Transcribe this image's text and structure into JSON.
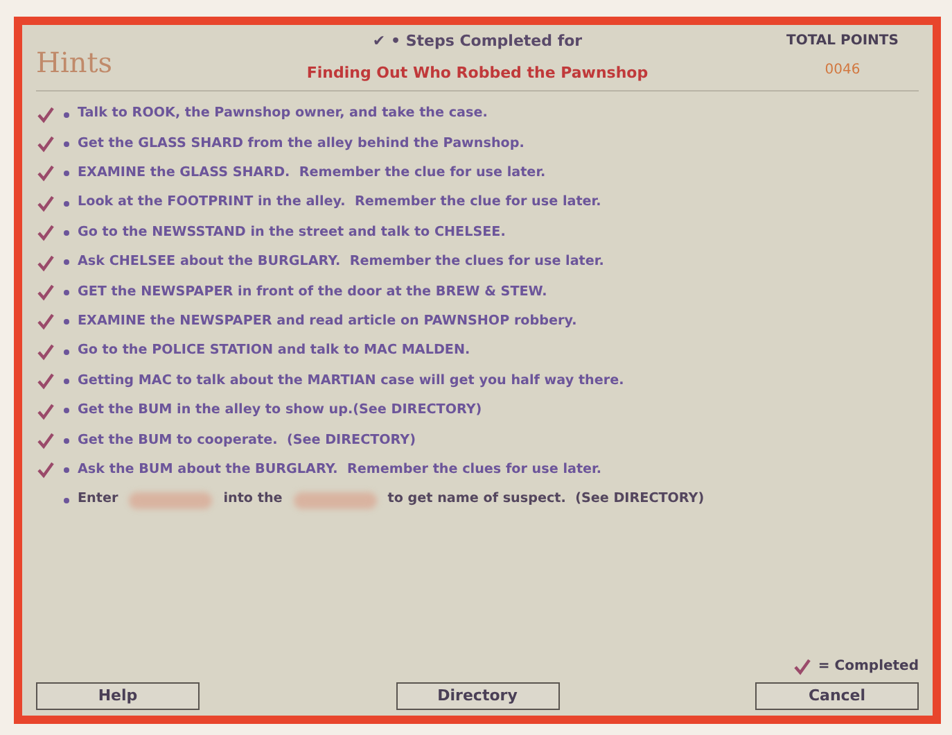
{
  "window": {
    "title": "Hints"
  },
  "header": {
    "legend": "✔ • Steps Completed for",
    "task": "Finding Out Who Robbed the Pawnshop",
    "points_label": "TOTAL POINTS",
    "points": "0046"
  },
  "steps": [
    {
      "checked": true,
      "parts": [
        {
          "kind": "text",
          "text": "Talk to ROOK, the Pawnshop owner, and take the case."
        }
      ]
    },
    {
      "checked": true,
      "parts": [
        {
          "kind": "text",
          "text": "Get the GLASS SHARD from the alley behind the Pawnshop."
        }
      ]
    },
    {
      "checked": true,
      "parts": [
        {
          "kind": "text",
          "text": "EXAMINE the GLASS SHARD.  Remember the clue for use later."
        }
      ]
    },
    {
      "checked": true,
      "parts": [
        {
          "kind": "text",
          "text": "Look at the FOOTPRINT in the alley.  Remember the clue for use later."
        }
      ]
    },
    {
      "checked": true,
      "parts": [
        {
          "kind": "text",
          "text": "Go to the NEWSSTAND in the street and talk to CHELSEE."
        }
      ]
    },
    {
      "checked": true,
      "parts": [
        {
          "kind": "text",
          "text": "Ask CHELSEE about the BURGLARY.  Remember the clues for use later."
        }
      ]
    },
    {
      "checked": true,
      "parts": [
        {
          "kind": "text",
          "text": "GET the NEWSPAPER in front of the door at the BREW & STEW."
        }
      ]
    },
    {
      "checked": true,
      "parts": [
        {
          "kind": "text",
          "text": "EXAMINE the NEWSPAPER and read article on PAWNSHOP robbery."
        }
      ]
    },
    {
      "checked": true,
      "parts": [
        {
          "kind": "text",
          "text": "Go to the POLICE STATION and talk to MAC MALDEN."
        }
      ]
    },
    {
      "checked": true,
      "parts": [
        {
          "kind": "text",
          "text": "Getting MAC to talk about the MARTIAN case will get you half way there."
        }
      ]
    },
    {
      "checked": true,
      "parts": [
        {
          "kind": "text",
          "text": "Get the BUM in the alley to show up.(See DIRECTORY)"
        }
      ]
    },
    {
      "checked": true,
      "parts": [
        {
          "kind": "text",
          "text": "Get the BUM to cooperate.  (See DIRECTORY)"
        }
      ]
    },
    {
      "checked": true,
      "parts": [
        {
          "kind": "text",
          "text": "Ask the BUM about the BURGLARY.  Remember the clues for use later."
        }
      ]
    },
    {
      "checked": false,
      "parts": [
        {
          "kind": "text",
          "text": "Enter"
        },
        {
          "kind": "hidden"
        },
        {
          "kind": "text",
          "text": "into the"
        },
        {
          "kind": "hidden"
        },
        {
          "kind": "text",
          "text": "to get name of suspect.  (See DIRECTORY)"
        }
      ]
    }
  ],
  "legend": {
    "text": "= Completed"
  },
  "buttons": [
    "Help",
    "Directory",
    "Cancel"
  ]
}
